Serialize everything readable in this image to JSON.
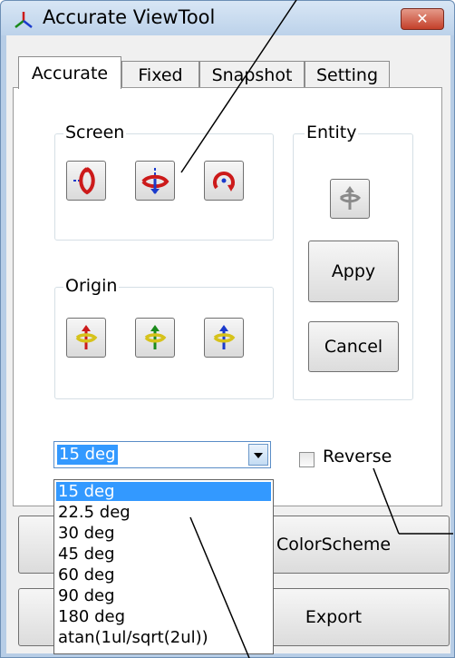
{
  "window": {
    "title": "Accurate ViewTool",
    "close_glyph": "✕",
    "app_icon": "accurate-viewtool-logo-icon"
  },
  "tabs": [
    {
      "label": "Accurate"
    },
    {
      "label": "Fixed"
    },
    {
      "label": "Snapshot"
    },
    {
      "label": "Setting"
    }
  ],
  "screen_group": {
    "label": "Screen",
    "buttons": [
      "rotate-horizontal-icon",
      "rotate-vertical-icon",
      "rotate-in-plane-icon"
    ]
  },
  "entity_group": {
    "label": "Entity",
    "icon": "entity-rotate-icon",
    "apply_label": "Appy",
    "cancel_label": "Cancel"
  },
  "origin_group": {
    "label": "Origin",
    "buttons": [
      "rotate-origin-x-icon",
      "rotate-origin-y-icon",
      "rotate-origin-z-icon"
    ]
  },
  "angle_combo": {
    "value": "15 deg",
    "options": [
      "15 deg",
      "22.5 deg",
      "30 deg",
      "45 deg",
      "60 deg",
      "90 deg",
      "180 deg",
      "atan(1ul/sqrt(2ul))"
    ]
  },
  "reverse_checkbox": {
    "label": "Reverse"
  },
  "bottom_buttons": {
    "colorscheme_label": "ColorScheme",
    "export_label": "Export"
  }
}
